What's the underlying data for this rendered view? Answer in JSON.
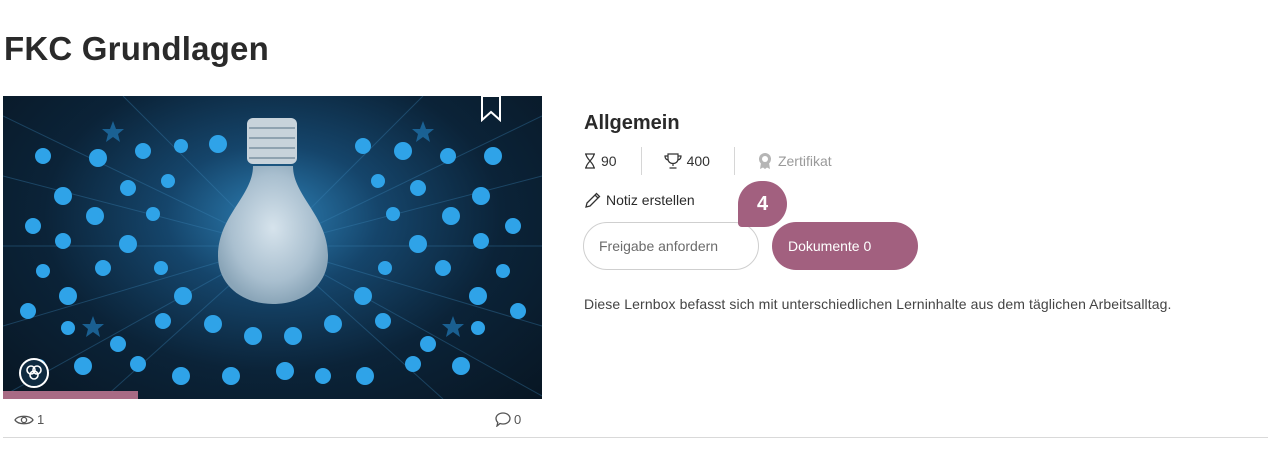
{
  "page": {
    "title": "FKC Grundlagen"
  },
  "card": {
    "views": "1",
    "comments": "0",
    "progress_fraction": 0.25
  },
  "detail": {
    "section_title": "Allgemein",
    "duration": "90",
    "points": "400",
    "certificate_label": "Zertifikat",
    "note_label": "Notiz erstellen",
    "request_button": "Freigabe anfordern",
    "documents_button": "Dokumente 0",
    "step_badge": "4",
    "description": "Diese Lernbox befasst sich mit unterschiedlichen Lerninhalte aus dem täglichen Arbeitsalltag."
  },
  "colors": {
    "accent": "#a2607f",
    "hero_glow": "#2d7fb4",
    "hero_dark": "#081623",
    "icons": "#2fa3e8"
  },
  "icons": [
    "bookmark-icon",
    "category-icon",
    "eye-icon",
    "comment-icon",
    "hourglass-icon",
    "trophy-icon",
    "certificate-icon",
    "pencil-icon"
  ]
}
